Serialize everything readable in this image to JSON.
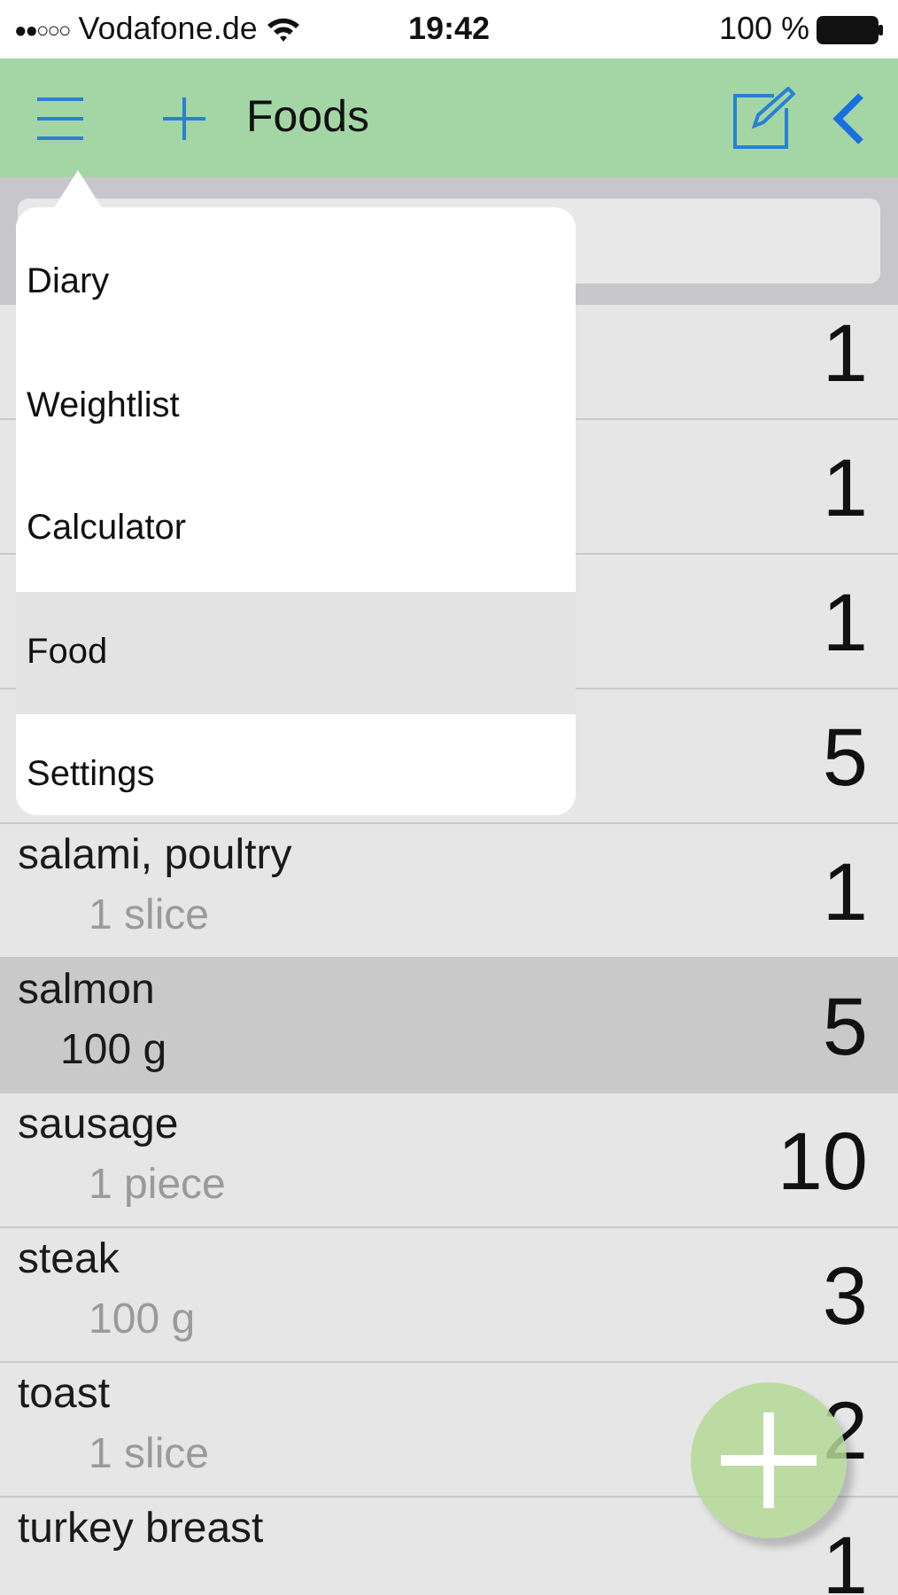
{
  "status_bar": {
    "signal": "●●○○○",
    "carrier": "Vodafone.de",
    "time": "19:42",
    "battery": "100 %"
  },
  "nav": {
    "title": "Foods"
  },
  "rows": [
    {
      "count": "1",
      "selected": false
    },
    {
      "count": "1",
      "selected": false
    },
    {
      "count": "1",
      "selected": false
    },
    {
      "count": "5",
      "selected": false
    },
    {
      "name": "salami, poultry",
      "portion": "1 slice",
      "count": "1",
      "selected": false
    },
    {
      "name": "salmon",
      "portion": "100 g",
      "count": "5",
      "selected": true
    },
    {
      "name": "sausage",
      "portion": "1 piece",
      "count": "10",
      "selected": false
    },
    {
      "name": "steak",
      "portion": "100 g",
      "count": "3",
      "selected": false
    },
    {
      "name": "toast",
      "portion": "1 slice",
      "count": "2",
      "selected": false
    },
    {
      "name": "turkey breast",
      "count": "1",
      "selected": false
    }
  ],
  "menu": {
    "items": [
      {
        "label": "Diary",
        "selected": false
      },
      {
        "label": "Weightlist",
        "selected": false
      },
      {
        "label": "Calculator",
        "selected": false
      },
      {
        "label": "Food",
        "selected": true
      },
      {
        "label": "Settings",
        "selected": false
      }
    ]
  }
}
